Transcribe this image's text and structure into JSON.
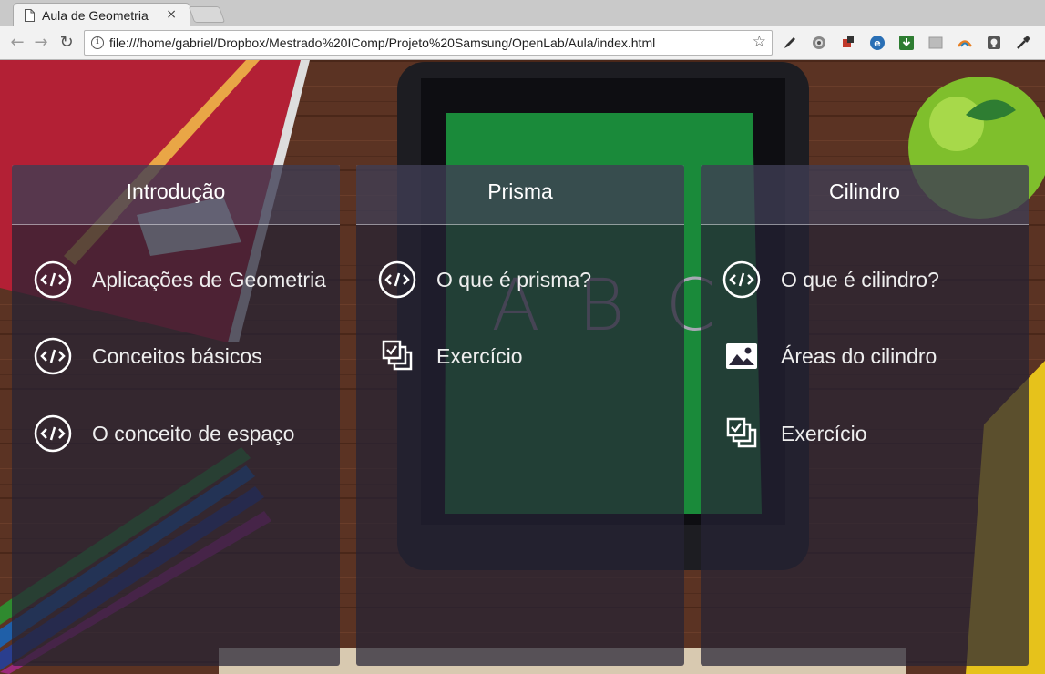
{
  "browser": {
    "tab_title": "Aula de Geometria",
    "tab_close": "×",
    "url": "file:///home/gabriel/Dropbox/Mestrado%20IComp/Projeto%20Samsung/OpenLab/Aula/index.html",
    "back": "←",
    "forward": "→",
    "reload": "↻",
    "star": "☆",
    "extensions": [
      "pen-icon",
      "globe-icon",
      "puzzle-icon",
      "e-icon",
      "download-icon",
      "box-icon",
      "arc-icon",
      "lightbulb-icon",
      "eyedropper-icon"
    ]
  },
  "background": {
    "letters": [
      "A",
      "B",
      "C"
    ]
  },
  "panels": [
    {
      "title": "Introdução",
      "items": [
        {
          "label": "Aplicações de Geometria",
          "icon": "code-icon"
        },
        {
          "label": "Conceitos básicos",
          "icon": "code-icon"
        },
        {
          "label": "O conceito de espaço",
          "icon": "code-icon"
        }
      ]
    },
    {
      "title": "Prisma",
      "items": [
        {
          "label": "O que é prisma?",
          "icon": "code-icon"
        },
        {
          "label": "Exercício",
          "icon": "checklist-icon"
        }
      ]
    },
    {
      "title": "Cilindro",
      "items": [
        {
          "label": "O que é cilindro?",
          "icon": "code-icon"
        },
        {
          "label": "Áreas do cilindro",
          "icon": "image-icon"
        },
        {
          "label": "Exercício",
          "icon": "checklist-icon"
        }
      ]
    }
  ],
  "colors": {
    "panel_bg": "#262234",
    "chalkboard": "#1a8a3a",
    "desk": "#5a3322"
  }
}
